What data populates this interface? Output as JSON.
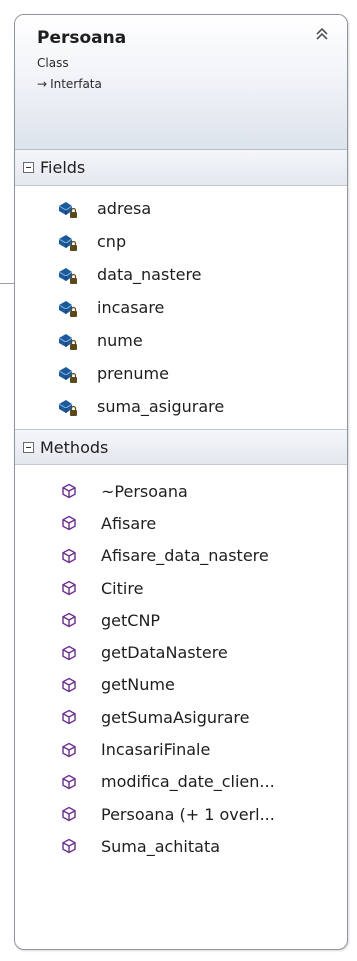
{
  "class": {
    "name": "Persoana",
    "stereotype": "Class",
    "base_arrow": "→",
    "base": "Interfata"
  },
  "sections": {
    "fields_label": "Fields",
    "methods_label": "Methods"
  },
  "fields": [
    "adresa",
    "cnp",
    "data_nastere",
    "incasare",
    "nume",
    "prenume",
    "suma_asigurare"
  ],
  "methods": [
    "~Persoana",
    "Afisare",
    "Afisare_data_nastere",
    "Citire",
    "getCNP",
    "getDataNastere",
    "getNume",
    "getSumaAsigurare",
    "IncasariFinale",
    "modifica_date_clien...",
    "Persoana (+ 1 overl...",
    "Suma_achitata"
  ],
  "colors": {
    "field_icon": "#1c5a9c",
    "method_icon": "#6a2e8f",
    "lock": "#5a4a1a"
  }
}
